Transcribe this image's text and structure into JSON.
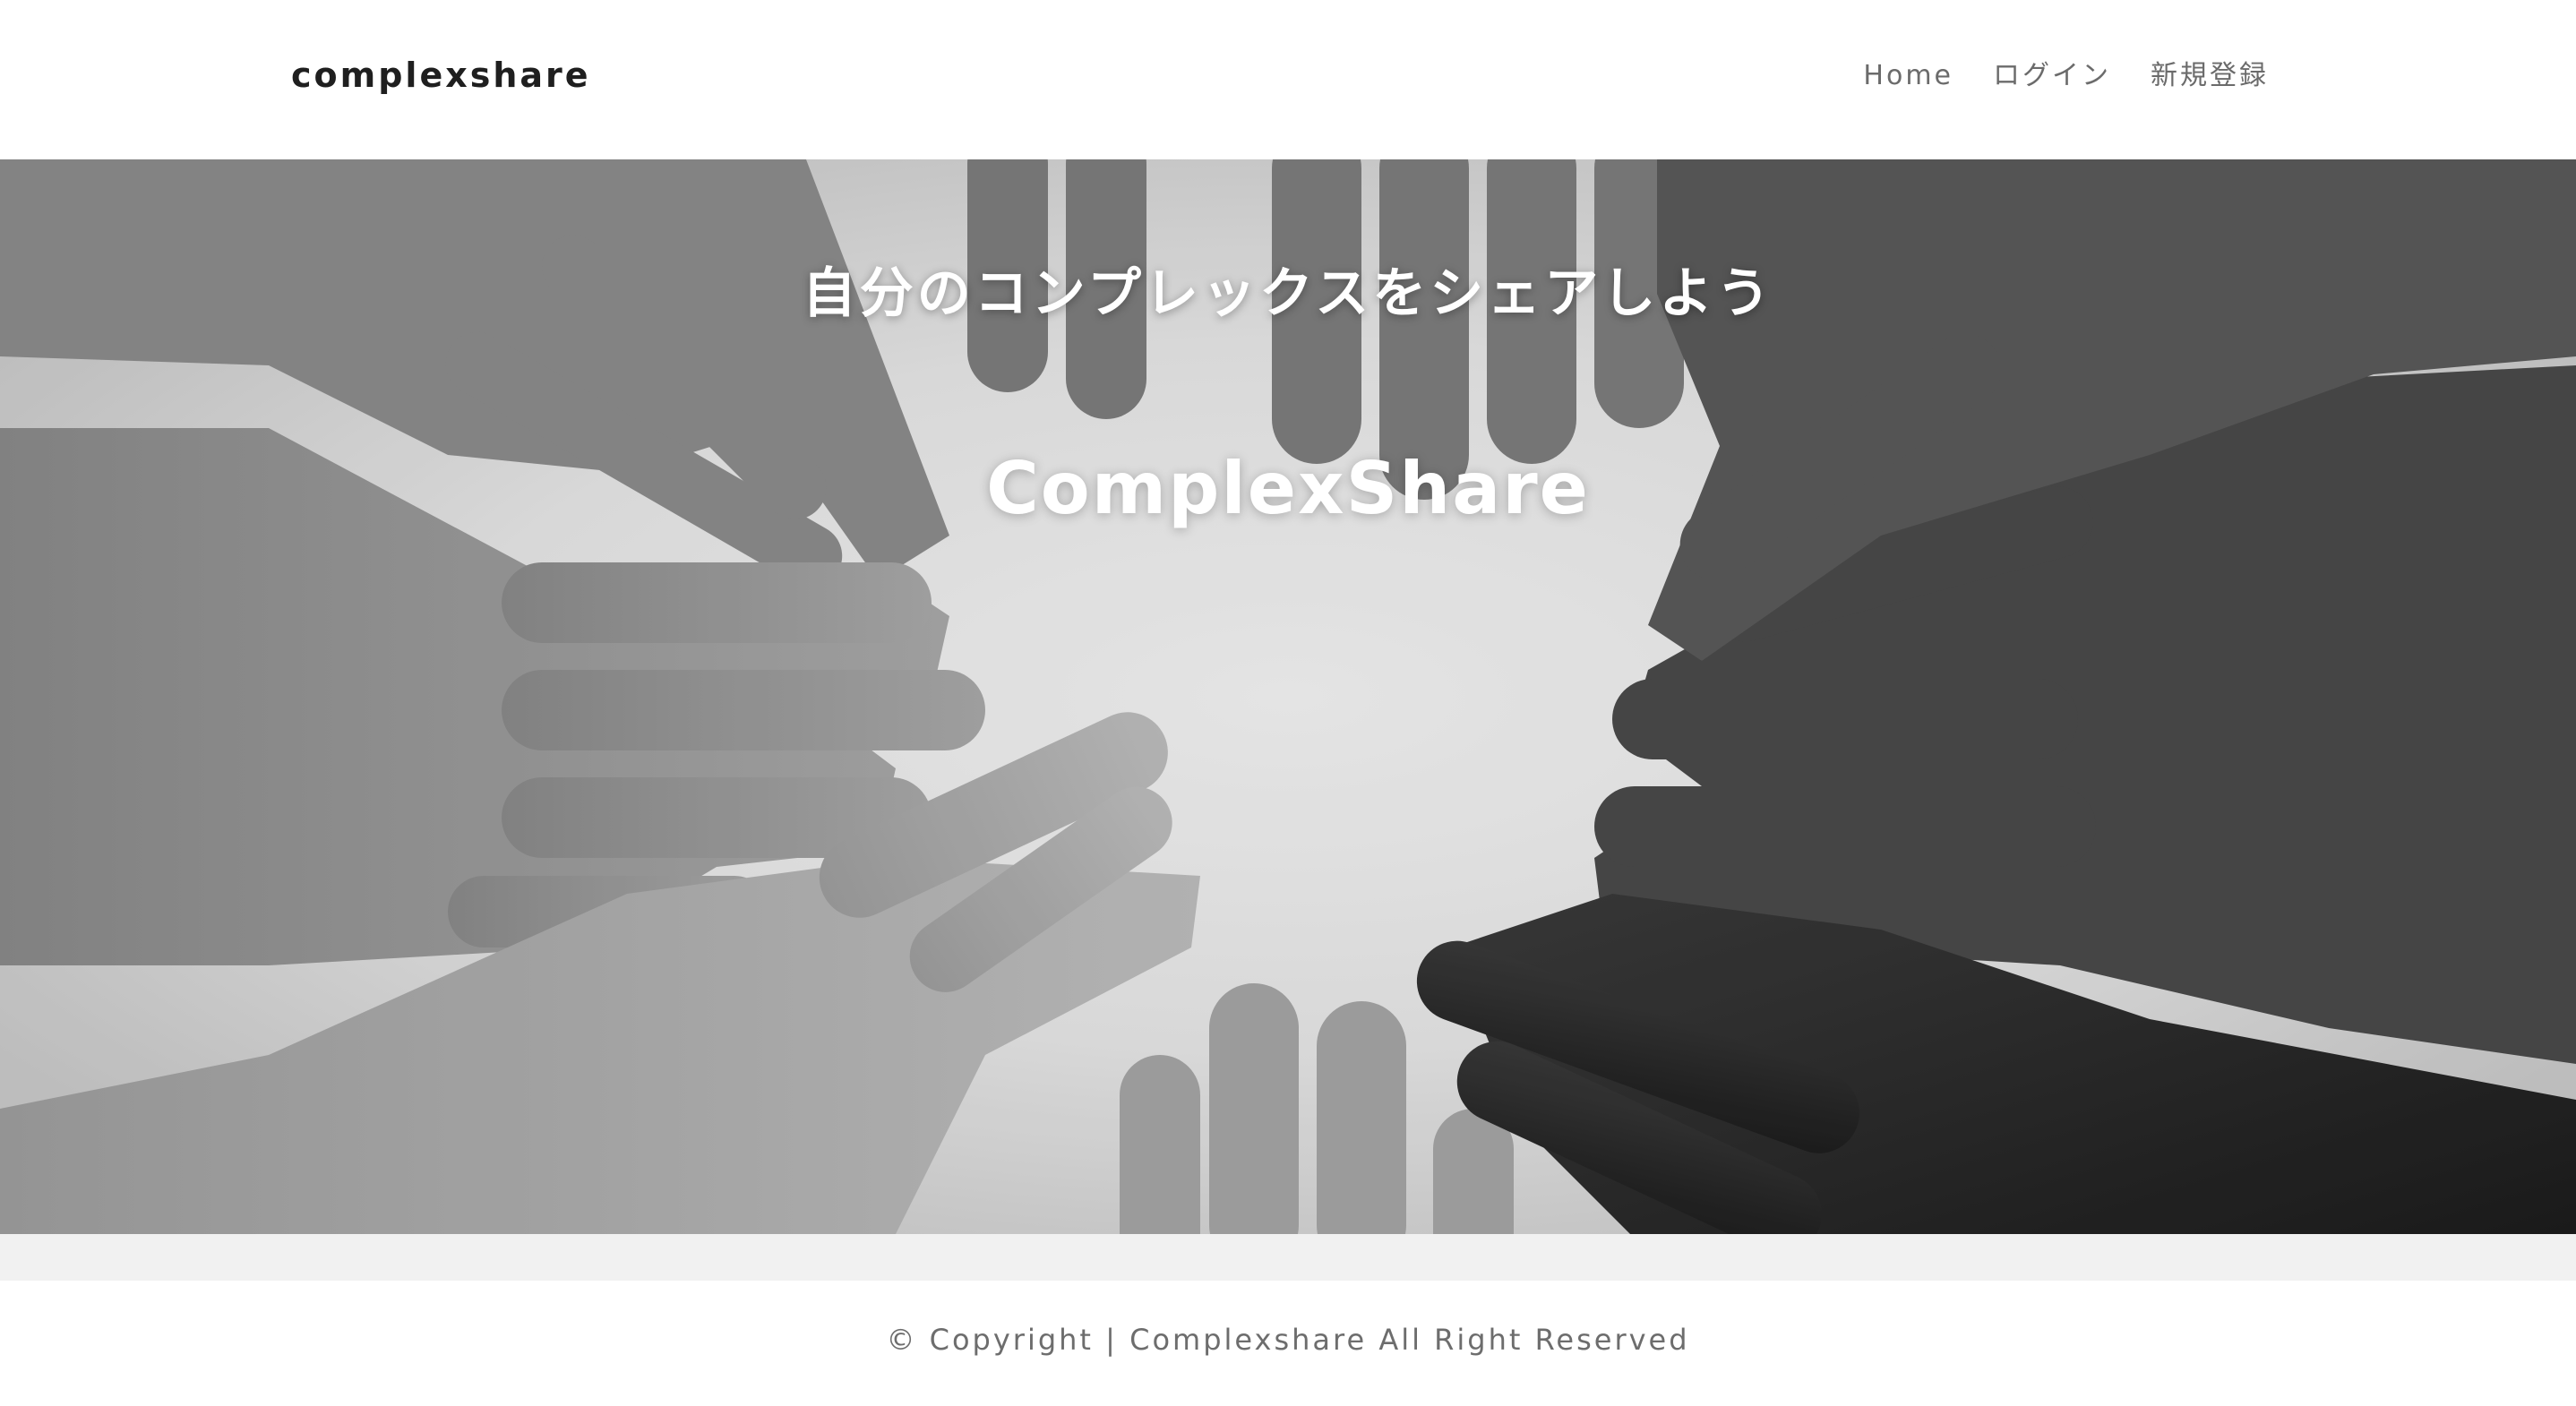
{
  "header": {
    "brand": "complexshare",
    "nav": [
      {
        "label": "Home"
      },
      {
        "label": "ログイン"
      },
      {
        "label": "新規登録"
      }
    ]
  },
  "hero": {
    "subtitle": "自分のコンプレックスをシェアしよう",
    "title": "ComplexShare",
    "image_icon": "hands-circle-photo"
  },
  "footer": {
    "copyright": "© Copyright | Complexshare All Right Reserved"
  },
  "colors": {
    "header_bg": "#ffffff",
    "brand_text": "#1f1f1f",
    "nav_text": "#6b6b6b",
    "hero_text": "#ffffff",
    "spacer_bg": "#f1f1f1",
    "footer_text": "#6d6d6d"
  }
}
